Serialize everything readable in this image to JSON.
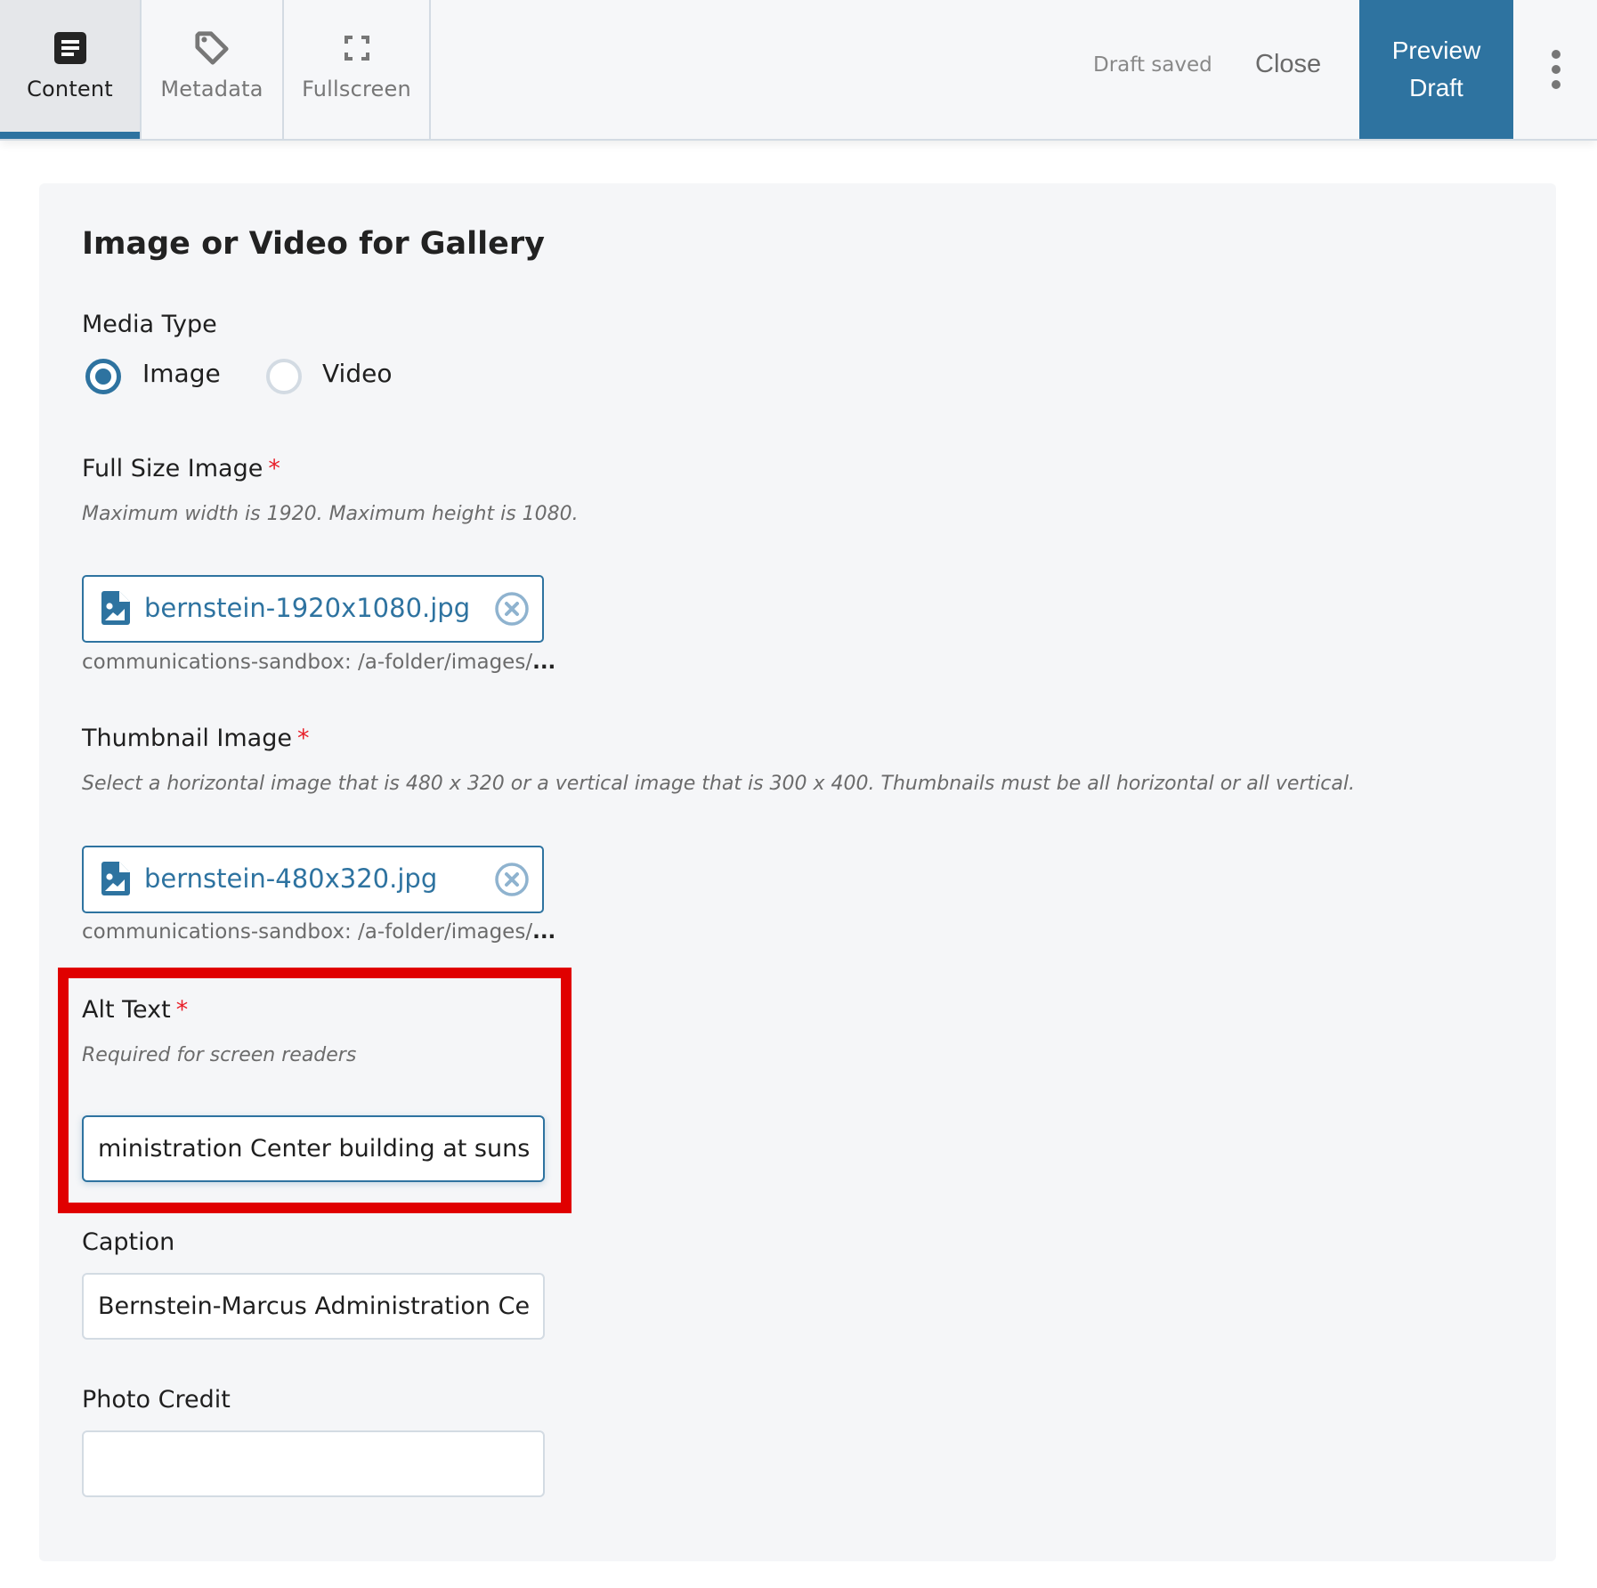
{
  "header": {
    "tabs": [
      {
        "label": "Content",
        "icon": "document-icon",
        "active": true
      },
      {
        "label": "Metadata",
        "icon": "tag-icon",
        "active": false
      },
      {
        "label": "Fullscreen",
        "icon": "fullscreen-icon",
        "active": false
      }
    ],
    "status": "Draft saved",
    "close_label": "Close",
    "preview_label_line1": "Preview",
    "preview_label_line2": "Draft",
    "more_icon": "more-vertical-icon"
  },
  "colors": {
    "accent": "#2e73a0",
    "required": "#e8202a",
    "highlight": "#e00000"
  },
  "form": {
    "title": "Image or Video for Gallery",
    "media_type": {
      "label": "Media Type",
      "options": [
        {
          "label": "Image",
          "checked": true
        },
        {
          "label": "Video",
          "checked": false
        }
      ]
    },
    "full_size_image": {
      "label": "Full Size Image",
      "required_mark": "*",
      "hint": "Maximum width is 1920. Maximum height is 1080.",
      "file_name": "bernstein-1920x1080.jpg",
      "path": "communications-sandbox: /a-folder/images/",
      "path_ellipsis": "..."
    },
    "thumbnail_image": {
      "label": "Thumbnail Image",
      "required_mark": "*",
      "hint": "Select a horizontal image that is 480 x 320 or a vertical image that is 300 x 400. Thumbnails must be all horizontal or all vertical.",
      "file_name": "bernstein-480x320.jpg",
      "path": "communications-sandbox: /a-folder/images/",
      "path_ellipsis": "..."
    },
    "alt_text": {
      "label": "Alt Text",
      "required_mark": "*",
      "hint": "Required for screen readers",
      "value": "ministration Center building at sunset"
    },
    "caption": {
      "label": "Caption",
      "value": "Bernstein-Marcus Administration Cer"
    },
    "photo_credit": {
      "label": "Photo Credit",
      "value": ""
    }
  }
}
